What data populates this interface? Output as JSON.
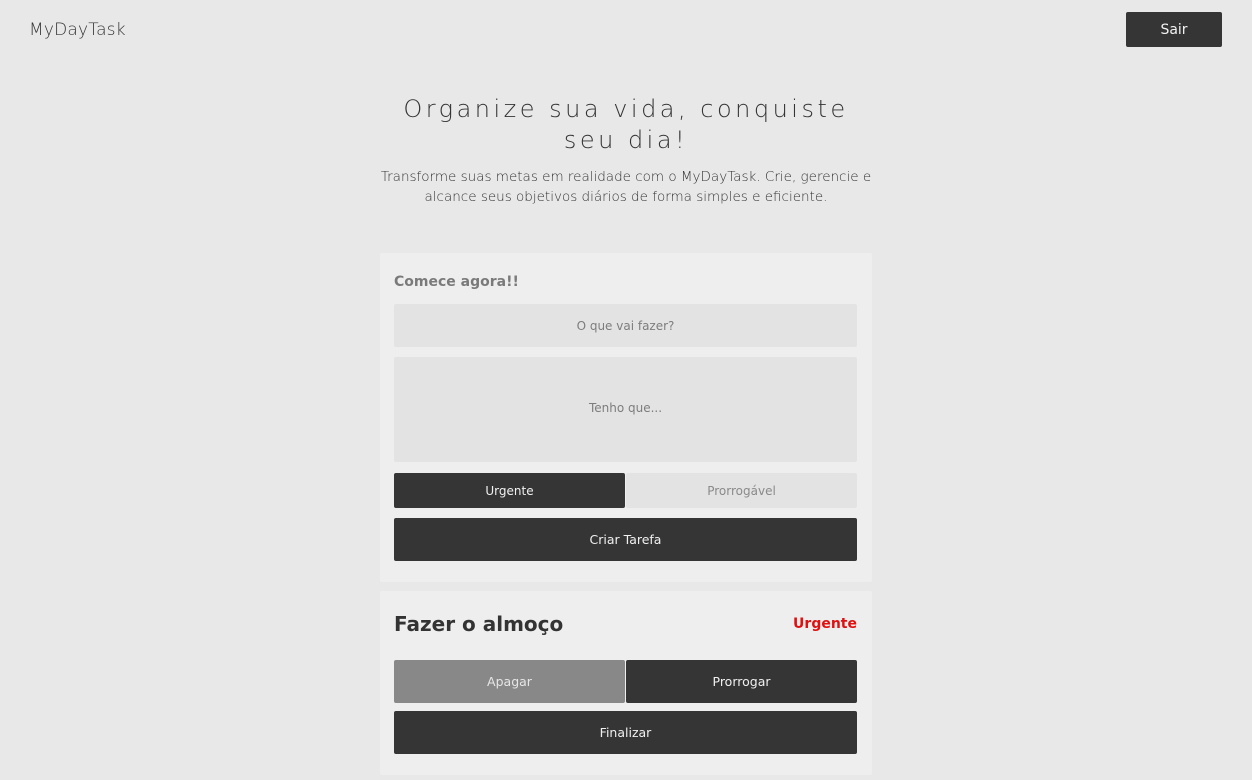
{
  "header": {
    "logo": "MyDayTask",
    "logout_label": "Sair"
  },
  "hero": {
    "title": "Organize sua vida, conquiste seu dia!",
    "subtitle": "Transforme suas metas em realidade com o MyDayTask. Crie, gerencie e alcance seus objetivos diários de forma simples e eficiente."
  },
  "create_form": {
    "heading": "Comece agora!!",
    "title_placeholder": "O que vai fazer?",
    "title_value": "",
    "description_placeholder": "Tenho que...",
    "description_value": "",
    "priority_options": [
      "Urgente",
      "Prorrogável"
    ],
    "selected_priority": "Urgente",
    "submit_label": "Criar Tarefa"
  },
  "tasks": [
    {
      "title": "Fazer o almoço",
      "priority": "Urgente",
      "priority_color": "#e01010",
      "delete_label": "Apagar",
      "postpone_label": "Prorrogar",
      "finish_label": "Finalizar"
    }
  ]
}
